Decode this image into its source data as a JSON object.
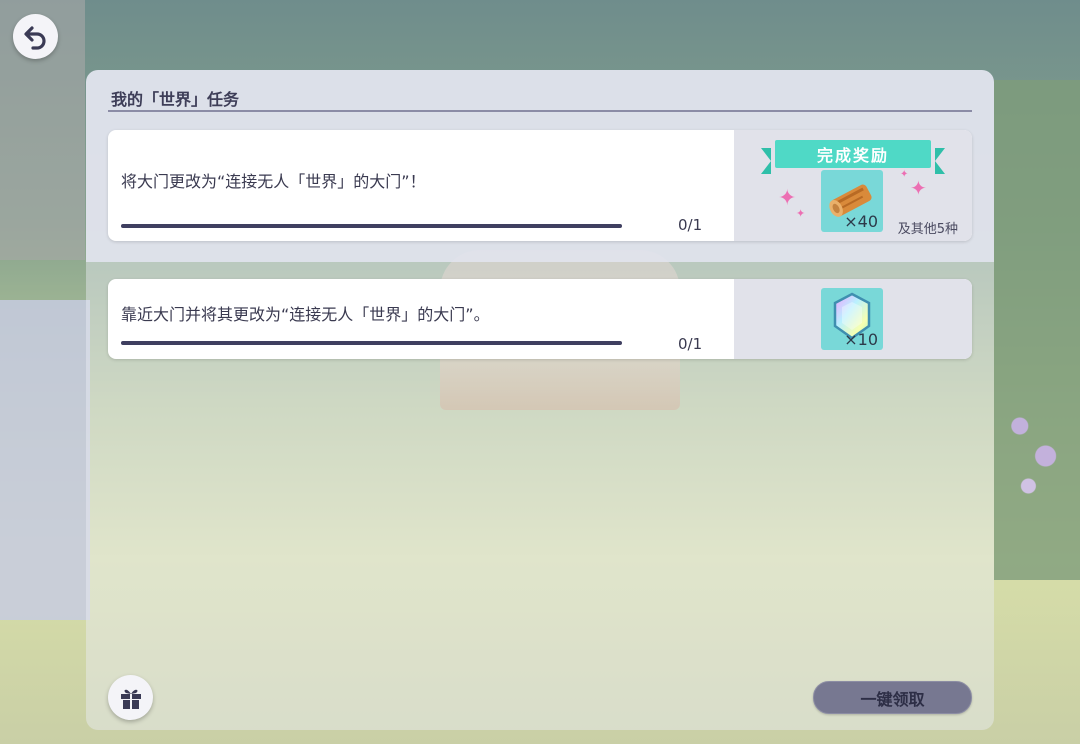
{
  "back": {
    "icon": "back-arrow-icon"
  },
  "panel": {
    "title": "我的「世界」任务"
  },
  "tasks": [
    {
      "description": "将大门更改为“连接无人「世界」的大门”！",
      "progress_value": 0,
      "progress_max": 1,
      "count_text": "0/1",
      "reward_banner": "完成奖励",
      "reward_icon": "wood-log-icon",
      "reward_qty": "×40",
      "reward_more": "及其他5种"
    },
    {
      "description": "靠近大门并将其更改为“连接无人「世界」的大门”。",
      "progress_value": 0,
      "progress_max": 1,
      "count_text": "0/1",
      "reward_icon": "crystal-icon",
      "reward_qty": "×10"
    }
  ],
  "gift": {
    "icon": "gift-icon"
  },
  "claim_button": {
    "label": "一键领取"
  },
  "colors": {
    "accent": "#4fd9c6",
    "progress": "#3f3f60",
    "sparkle": "#ec6fb3"
  }
}
